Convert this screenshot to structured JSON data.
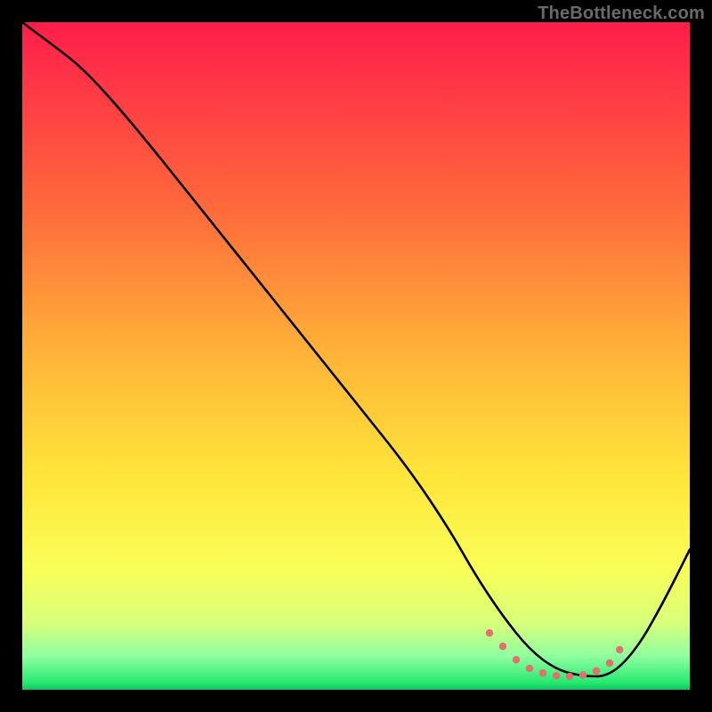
{
  "watermark": "TheBottleneck.com",
  "chart_data": {
    "type": "line",
    "title": "",
    "xlabel": "",
    "ylabel": "",
    "xlim": [
      0,
      100
    ],
    "ylim": [
      0,
      100
    ],
    "annotations": [],
    "background_gradient": {
      "stops": [
        {
          "offset": 0,
          "color": "#ff1d4b"
        },
        {
          "offset": 28,
          "color": "#ff6a3b"
        },
        {
          "offset": 50,
          "color": "#ffb438"
        },
        {
          "offset": 68,
          "color": "#ffe53a"
        },
        {
          "offset": 82,
          "color": "#f9ff57"
        },
        {
          "offset": 90,
          "color": "#d8ff7a"
        },
        {
          "offset": 95,
          "color": "#8fffa0"
        },
        {
          "offset": 99,
          "color": "#25e86f"
        },
        {
          "offset": 100,
          "color": "#11c560"
        }
      ]
    },
    "series": [
      {
        "name": "bottleneck-curve",
        "color": "#000000",
        "x": [
          0,
          4,
          8,
          12,
          18,
          26,
          34,
          42,
          50,
          58,
          64,
          68,
          72,
          76,
          80,
          84,
          88,
          92,
          96,
          100
        ],
        "y": [
          100,
          97,
          94,
          90,
          83,
          73,
          63,
          53,
          43,
          33,
          24,
          17,
          11,
          6,
          3,
          2,
          2,
          6,
          13,
          21
        ]
      }
    ],
    "markers": {
      "name": "optimal-range",
      "color": "#e2706f",
      "radius": 4.2,
      "points": [
        {
          "x": 70,
          "y": 8.5
        },
        {
          "x": 72,
          "y": 6.5
        },
        {
          "x": 74,
          "y": 4.5
        },
        {
          "x": 76,
          "y": 3.2
        },
        {
          "x": 78,
          "y": 2.5
        },
        {
          "x": 80,
          "y": 2.1
        },
        {
          "x": 82,
          "y": 2.0
        },
        {
          "x": 84,
          "y": 2.2
        },
        {
          "x": 86,
          "y": 2.8
        },
        {
          "x": 88,
          "y": 4.0
        },
        {
          "x": 89.5,
          "y": 6.0
        }
      ]
    }
  }
}
